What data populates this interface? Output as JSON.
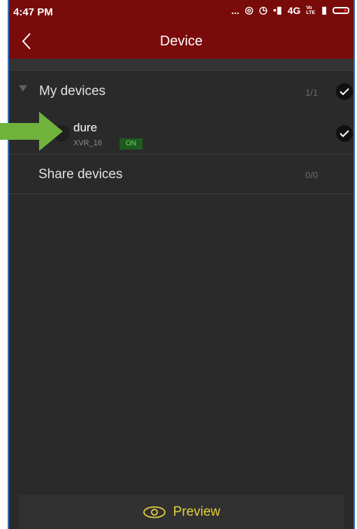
{
  "status": {
    "time": "4:47 PM",
    "dots": "...",
    "network": "4G",
    "volte": "Vo LTE"
  },
  "nav": {
    "title": "Device"
  },
  "my_devices": {
    "label": "My devices",
    "count": "1/1"
  },
  "device": {
    "name": "dure",
    "model": "XVR_16",
    "state": "ON"
  },
  "share_devices": {
    "label": "Share devices",
    "count": "0/0"
  },
  "bottom": {
    "preview_label": "Preview"
  },
  "colors": {
    "header": "#7a0b0b",
    "background": "#2a2a2a",
    "accent": "#e2d23a",
    "on_badge": "#1f5b1f",
    "arrow": "#6fb33c"
  }
}
